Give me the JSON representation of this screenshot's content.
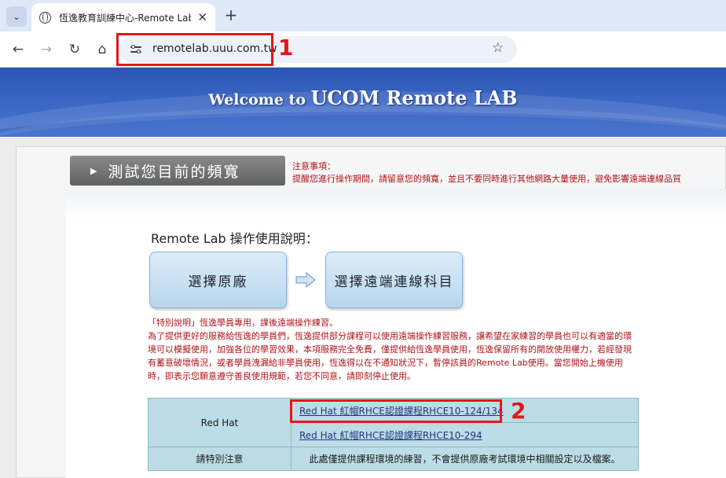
{
  "browser": {
    "tab_title": "恆逸教育訓練中心-Remote Lab",
    "tab_close": "✕",
    "new_tab": "+",
    "tab_menu": "⌄",
    "url": "remotelab.uuu.com.tw",
    "back": "←",
    "forward": "→",
    "reload": "↻",
    "home": "⌂",
    "star": "☆"
  },
  "annotations": {
    "one": "1",
    "two": "2",
    "color": "#e8141c"
  },
  "banner": {
    "welcome": "Welcome to ",
    "brand": "UCOM Remote LAB"
  },
  "speed_test": {
    "label": "測試您目前的頻寬"
  },
  "notice": {
    "title": "注意事項：",
    "body": "提醒您進行操作期間，請留意您的頻寬，並且不要同時進行其他網路大量使用，避免影響遠端連線品質"
  },
  "guide": {
    "title": "Remote Lab 操作使用說明：",
    "step1": "選擇原廠",
    "step2": "選擇遠端連線科目"
  },
  "special_notice": {
    "line1": "「特別說明」恆逸學員專用，課後遠端操作練習。",
    "body": "為了提供更好的服務給恆逸的學員們，恆逸提供部分課程可以使用遠端操作練習服務，讓希望在家練習的學員也可以有適當的環境可以模擬使用，加強各位的學習效果，本項服務完全免費，僅提供給恆逸學員使用，恆逸保留所有的開放使用權力，若經發現有蓄意破壞情況，或者學員洩漏給非學員使用，恆逸得以在不通知狀況下，暫停該員的Remote Lab使用。當您開始上機使用時，即表示您願意遵守善良使用規範，若您不同意，請即刻停止使用。"
  },
  "table": {
    "vendor": "Red Hat",
    "course1": "Red Hat 紅帽RHCE認證課程RHCE10-124/134",
    "course2": "Red Hat 紅帽RHCE認證課程RHCE10-294",
    "note_label": "請特別注意",
    "note_text": "此處僅提供課程環境的練習，不會提供原廠考試環境中相關設定以及檔案。"
  }
}
